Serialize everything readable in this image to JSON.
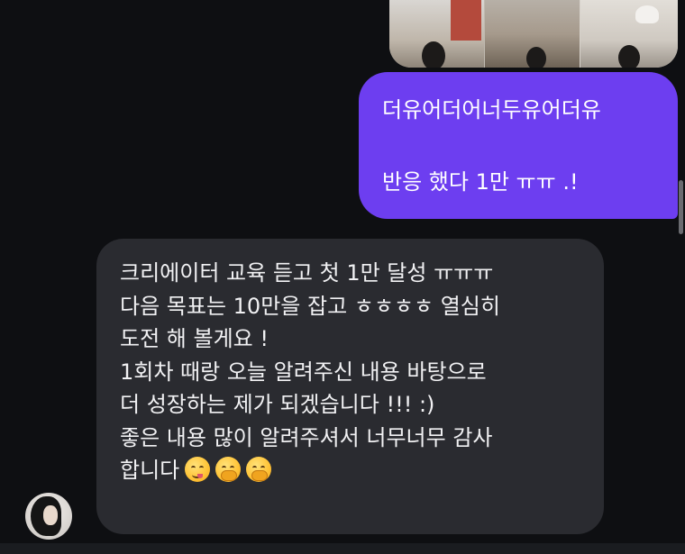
{
  "sent_message": {
    "line1": "더유어더어너두유어더유",
    "line2": "반응 했다 1만 ㅠㅠ .!"
  },
  "received_message": {
    "lines": [
      "크리에이터 교육 듣고 첫 1만 달성 ㅠㅠㅠ",
      "다음 목표는 10만을 잡고 ㅎㅎㅎㅎ 열심히",
      "도전 해 볼게요 !",
      "1회차 때랑 오늘 알려주신 내용 바탕으로",
      "더 성장하는 제가 되겠습니다 !!! :)",
      "좋은 내용 많이 알려주셔서 너무너무 감사",
      "합니다"
    ],
    "emojis": [
      "savoring-face-emoji",
      "hand-over-mouth-emoji",
      "hand-over-mouth-emoji"
    ]
  },
  "colors": {
    "background": "#0e0f12",
    "sent_bubble": "#6d3ef0",
    "received_bubble": "#2a2b30"
  }
}
